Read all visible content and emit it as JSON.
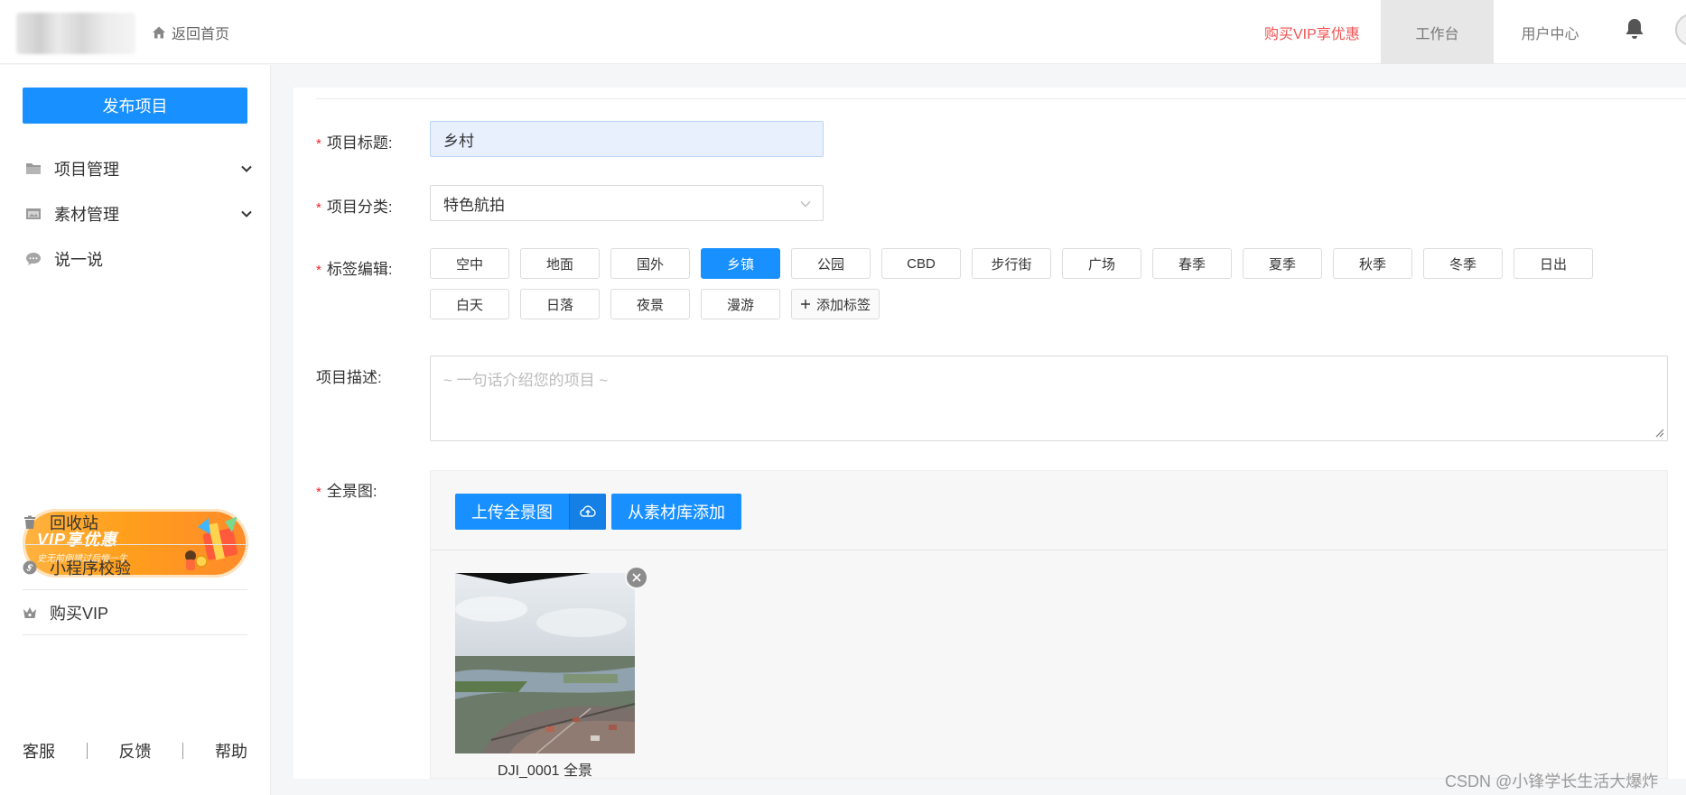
{
  "header": {
    "home_label": "返回首页",
    "vip_promo": "购买VIP享优惠",
    "nav_workbench": "工作台",
    "nav_user_center": "用户中心"
  },
  "sidebar": {
    "publish_button": "发布项目",
    "menu": [
      {
        "label": "项目管理",
        "icon": "folder-icon",
        "expandable": true
      },
      {
        "label": "素材管理",
        "icon": "media-folder-icon",
        "expandable": true
      },
      {
        "label": "说一说",
        "icon": "chat-bubble-icon",
        "expandable": false
      }
    ],
    "vip_banner": {
      "title": "VIP享优惠",
      "subtitle": "史无前例错过后悔一生"
    },
    "bottom_menu": [
      {
        "label": "回收站",
        "icon": "trash-icon"
      },
      {
        "label": "小程序校验",
        "icon": "miniprogram-icon"
      },
      {
        "label": "购买VIP",
        "icon": "vip-crown-icon"
      }
    ],
    "footer": {
      "service": "客服",
      "feedback": "反馈",
      "help": "帮助"
    }
  },
  "form": {
    "title_label": "项目标题:",
    "title_value": "乡村",
    "category_label": "项目分类:",
    "category_value": "特色航拍",
    "tags_label": "标签编辑:",
    "tags": [
      "空中",
      "地面",
      "国外",
      "乡镇",
      "公园",
      "CBD",
      "步行街",
      "广场",
      "春季",
      "夏季",
      "秋季",
      "冬季",
      "日出",
      "白天",
      "日落",
      "夜景",
      "漫游"
    ],
    "active_tag": "乡镇",
    "add_tag_label": "添加标签",
    "description_label": "项目描述:",
    "description_placeholder": "~ 一句话介绍您的项目 ~",
    "panorama_label": "全景图:",
    "upload_button": "上传全景图",
    "library_button": "从素材库添加",
    "panorama_items": [
      {
        "caption": "DJI_0001 全景"
      }
    ]
  },
  "colors": {
    "primary": "#1890ff",
    "required": "#f5222d",
    "vip_red": "#f25252",
    "banner_orange": "#ff9f1c"
  },
  "watermark": "CSDN @小锋学长生活大爆炸"
}
